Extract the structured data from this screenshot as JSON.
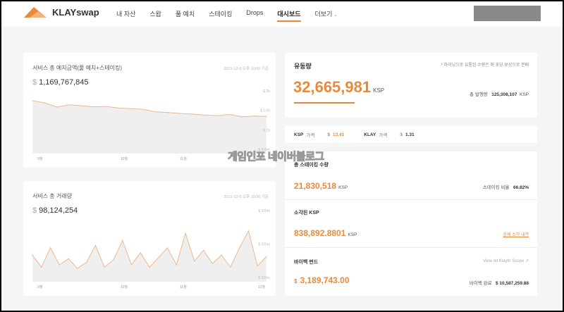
{
  "header": {
    "logo_text": "KLAYswap",
    "menu": [
      {
        "label": "내 자산"
      },
      {
        "label": "스왑"
      },
      {
        "label": "풀 예치"
      },
      {
        "label": "스테이킹"
      },
      {
        "label": "Drops"
      },
      {
        "label": "대시보드",
        "active": true
      },
      {
        "label": "더보기"
      }
    ]
  },
  "deposit_chart": {
    "title": "서비스 총 예치금액(풀 예치+스테이킹)",
    "timestamp": "2021-12-5 오후 10:00 기준",
    "currency": "$",
    "value": "1,169,767,845",
    "y_labels": [
      "$ 2b",
      "$ 1.5b",
      "$ 1b",
      "$ 500m"
    ],
    "x_labels": [
      "9월",
      "10월",
      "11월",
      "12월"
    ]
  },
  "volume_chart": {
    "title": "서비스 총 거래량",
    "timestamp": "2021-12-5 오후 10:00 기준",
    "currency": "$",
    "value": "98,124,254",
    "y_labels": [
      "$ 300m",
      "$ 200m",
      "$ 100m"
    ],
    "x_labels": [
      "9월",
      "10월",
      "11월",
      "12월"
    ]
  },
  "chart_data": [
    {
      "type": "area",
      "title": "서비스 총 예치금액(풀 예치+스테이킹)",
      "x": [
        "9월",
        "10월",
        "11월",
        "12월"
      ],
      "ylim": [
        0,
        2000000000
      ],
      "series": [
        {
          "values": [
            1650000000,
            1580000000,
            1450000000,
            1520000000,
            1490000000,
            1460000000,
            1470000000,
            1420000000,
            1400000000,
            1380000000,
            1300000000,
            1280000000,
            1250000000,
            1230000000,
            1200000000,
            1180000000,
            1220000000,
            1150000000,
            1170000000,
            1160000000
          ]
        }
      ]
    },
    {
      "type": "area",
      "title": "서비스 총 거래량",
      "x": [
        "9월",
        "10월",
        "11월",
        "12월"
      ],
      "ylim": [
        0,
        300000000
      ],
      "series": [
        {
          "values": [
            110000000,
            60000000,
            140000000,
            70000000,
            95000000,
            55000000,
            80000000,
            150000000,
            60000000,
            90000000,
            170000000,
            70000000,
            120000000,
            60000000,
            100000000,
            140000000,
            70000000,
            200000000,
            85000000,
            130000000,
            75000000,
            110000000,
            60000000,
            140000000,
            210000000,
            65000000,
            105000000
          ]
        }
      ]
    }
  ],
  "circulation": {
    "title": "유동량",
    "note": "* 마이닝으로 유통된 수량은 매 초당 보상으로 분배",
    "value": "32,665,981",
    "unit": "KSP",
    "total_label": "총 발행량",
    "total_value": "125,308,107",
    "total_unit": "KSP"
  },
  "prices": {
    "ksp_label": "KSP",
    "ksp_suffix": "가격",
    "ksp_currency": "$",
    "ksp_value": "13.41",
    "klay_label": "KLAY",
    "klay_suffix": "가격",
    "klay_currency": "$",
    "klay_value": "1.31"
  },
  "staking": {
    "title": "총 스테이킹 수량",
    "value": "21,830,518",
    "unit": "KSP",
    "ratio_label": "스테이킹 비율",
    "ratio_value": "66.82%"
  },
  "burned": {
    "title": "소각된 KSP",
    "value": "838,892.8801",
    "unit": "KSP",
    "link": "상세 소각 내역"
  },
  "buyback": {
    "title": "바이백 펀드",
    "currency": "$",
    "value": "3,189,743.00",
    "link": "View on Klaytn Scope ↗",
    "done_label": "바이백 완료",
    "done_value": "$ 10,587,259.88"
  },
  "watermark": "게임인포 네이버블로그"
}
